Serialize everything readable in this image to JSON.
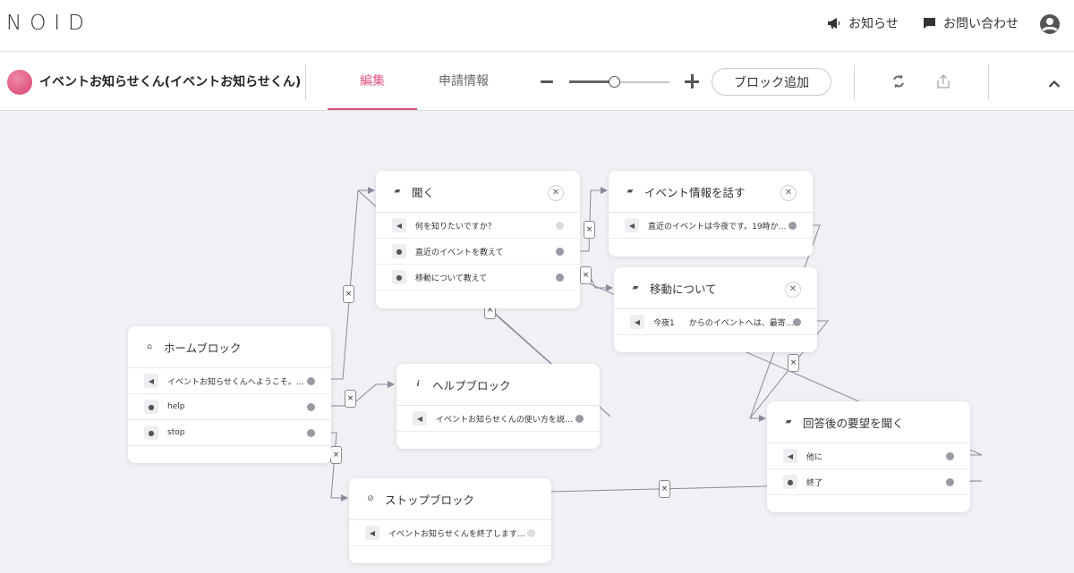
{
  "app": {
    "logo": "NOID"
  },
  "topnav": {
    "news": "お知らせ",
    "contact": "お問い合わせ"
  },
  "project": {
    "name": "イベントお知らせくん(イベントお知らせくん)"
  },
  "tabs": {
    "edit": "編集",
    "apply": "申請情報"
  },
  "zoom": {
    "level": 0.45
  },
  "toolbar": {
    "add_block": "ブロック追加"
  },
  "colors": {
    "accent": "#e0547b",
    "port": "#9a9aa4",
    "line": "#8a8a9a"
  },
  "icons": {
    "news": "megaphone-icon",
    "contact": "chat-icon",
    "user": "user-icon",
    "refresh": "refresh-icon",
    "export": "export-icon",
    "collapse": "chevron-up-icon"
  },
  "blocks": {
    "home": {
      "title": "ホームブロック",
      "rows": [
        "イベントお知らせくんへようこそ。…",
        "help",
        "stop"
      ]
    },
    "listen": {
      "title": "聞く",
      "rows": [
        "何を知りたいですか？",
        "直近のイベントを教えて",
        "移動について教えて"
      ]
    },
    "event": {
      "title": "イベント情報を話す",
      "rows": [
        "直近のイベントは今夜です。19時か…"
      ]
    },
    "move": {
      "title": "移動について",
      "rows": [
        "今夜1",
        "からのイベントへは、最寄…"
      ]
    },
    "help": {
      "title": "ヘルプブロック",
      "rows": [
        "イベントお知らせくんの使い方を説…"
      ]
    },
    "stop": {
      "title": "ストップブロック",
      "rows": [
        "イベントお知らせくんを終了します…"
      ]
    },
    "after": {
      "title": "回答後の要望を聞く",
      "rows": [
        "他に",
        "終了"
      ]
    }
  },
  "connector_label": "×"
}
